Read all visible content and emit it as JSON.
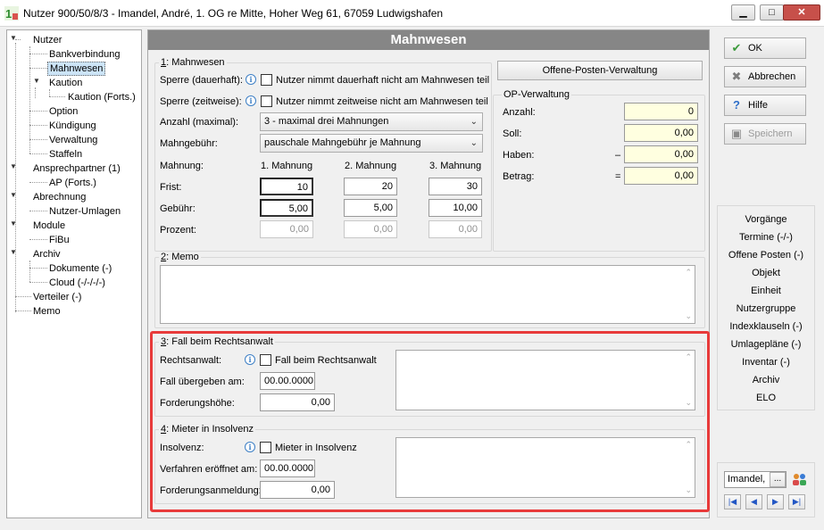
{
  "window": {
    "title": "Nutzer 900/50/8/3 - Imandel, André, 1. OG re Mitte, Hoher Weg 61, 67059 Ludwigshafen",
    "minimize": "▁",
    "maximize": "□",
    "close": "✕"
  },
  "tree": {
    "nutzer": "Nutzer",
    "bankverbindung": "Bankverbindung",
    "mahnwesen": "Mahnwesen",
    "kaution": "Kaution",
    "kaution_forts": "Kaution (Forts.)",
    "option": "Option",
    "kuendigung": "Kündigung",
    "verwaltung": "Verwaltung",
    "staffeln": "Staffeln",
    "ansprechpartner": "Ansprechpartner (1)",
    "ap_forts": "AP (Forts.)",
    "abrechnung": "Abrechnung",
    "nutzer_umlagen": "Nutzer-Umlagen",
    "module": "Module",
    "fibu": "FiBu",
    "archiv": "Archiv",
    "dokumente": "Dokumente (-)",
    "cloud": "Cloud (-/-/-/-)",
    "verteiler": "Verteiler (-)",
    "memo": "Memo"
  },
  "header": {
    "title": "Mahnwesen"
  },
  "mahnwesen": {
    "group_num": "1",
    "group_label": ": Mahnwesen",
    "sperre_dauer_label": "Sperre (dauerhaft):",
    "sperre_dauer_check": "Nutzer nimmt dauerhaft nicht am Mahnwesen teil",
    "sperre_zeit_label": "Sperre (zeitweise):",
    "sperre_zeit_check": "Nutzer nimmt zeitweise nicht am Mahnwesen teil",
    "anzahl_label": "Anzahl (maximal):",
    "anzahl_value": "3 - maximal drei Mahnungen",
    "gebuehr_label": "Mahngebühr:",
    "gebuehr_value": "pauschale Mahngebühr je Mahnung",
    "mahnung_label": "Mahnung:",
    "col1": "1. Mahnung",
    "col2": "2. Mahnung",
    "col3": "3. Mahnung",
    "frist_label": "Frist:",
    "frist": [
      "10",
      "20",
      "30"
    ],
    "gebuehr_row_label": "Gebühr:",
    "gebuehr_row": [
      "5,00",
      "5,00",
      "10,00"
    ],
    "prozent_label": "Prozent:",
    "prozent": [
      "0,00",
      "0,00",
      "0,00"
    ]
  },
  "op": {
    "button": "Offene-Posten-Verwaltung",
    "group_label": "OP-Verwaltung",
    "anzahl_label": "Anzahl:",
    "anzahl": "0",
    "soll_label": "Soll:",
    "soll": "0,00",
    "haben_label": "Haben:",
    "haben_sign": "–",
    "haben": "0,00",
    "betrag_label": "Betrag:",
    "betrag_sign": "=",
    "betrag": "0,00"
  },
  "memo": {
    "group_num": "2",
    "group_label": ": Memo",
    "text": ""
  },
  "rechtsanwalt": {
    "group_num": "3",
    "group_label": ": Fall beim Rechtsanwalt",
    "ra_label": "Rechtsanwalt:",
    "ra_check": "Fall beim Rechtsanwalt",
    "uebergeben_label": "Fall übergeben am:",
    "uebergeben": "00.00.0000",
    "forderung_label": "Forderungshöhe:",
    "forderung": "0,00"
  },
  "insolvenz": {
    "group_num": "4",
    "group_label": ": Mieter in Insolvenz",
    "ins_label": "Insolvenz:",
    "ins_check": "Mieter in Insolvenz",
    "verfahren_label": "Verfahren eröffnet am:",
    "verfahren": "00.00.0000",
    "anmeldung_label": "Forderungsanmeldung:",
    "anmeldung": "0,00"
  },
  "actions": {
    "ok": "OK",
    "abbrechen": "Abbrechen",
    "hilfe": "Hilfe",
    "speichern": "Speichern"
  },
  "links": [
    "Vorgänge",
    "Termine (-/-)",
    "Offene Posten (-)",
    "Objekt",
    "Einheit",
    "Nutzergruppe",
    "Indexklauseln (-)",
    "Umlagepläne (-)",
    "Inventar (-)",
    "Archiv",
    "ELO"
  ],
  "nav": {
    "name": "Imandel,",
    "dots": "...",
    "first": "|◀",
    "prev": "◀",
    "next": "▶",
    "last": "▶|"
  },
  "colors": {
    "header_bg": "#868686",
    "highlight_frame": "#e83a3a",
    "readonly_field": "#ffffe0"
  }
}
